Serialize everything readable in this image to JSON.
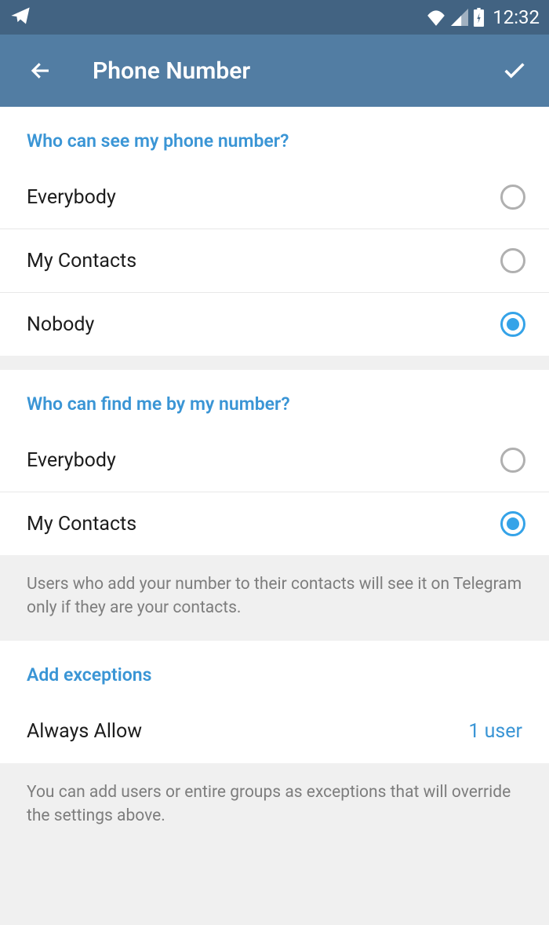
{
  "status_bar": {
    "time": "12:32"
  },
  "app_bar": {
    "title": "Phone Number"
  },
  "sections": {
    "see_number": {
      "header": "Who can see my phone number?",
      "options": [
        {
          "label": "Everybody",
          "selected": false
        },
        {
          "label": "My Contacts",
          "selected": false
        },
        {
          "label": "Nobody",
          "selected": true
        }
      ]
    },
    "find_number": {
      "header": "Who can find me by my number?",
      "options": [
        {
          "label": "Everybody",
          "selected": false
        },
        {
          "label": "My Contacts",
          "selected": true
        }
      ],
      "footer": "Users who add your number to their contacts will see it on Telegram only if they are your contacts."
    },
    "exceptions": {
      "header": "Add exceptions",
      "row": {
        "label": "Always Allow",
        "value": "1 user"
      },
      "footer": "You can add users or entire groups as exceptions that will override the settings above."
    }
  }
}
